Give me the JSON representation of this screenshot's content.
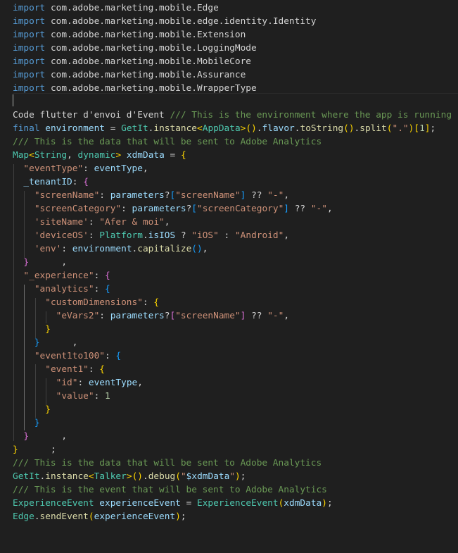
{
  "colors": {
    "background": "#1f1f1f",
    "keyword": "#569cd6",
    "control": "#c586c0",
    "type": "#4ec9b0",
    "function": "#dcdcaa",
    "variable": "#9cdcfe",
    "string": "#ce9178",
    "number": "#b5cea8",
    "comment": "#6a9955",
    "plain": "#d4d4d4",
    "bracket_level_1": "#ffd700",
    "bracket_level_2": "#da70d6",
    "bracket_level_3": "#179fff"
  },
  "code_lines": [
    [
      [
        "kw",
        "import"
      ],
      [
        "p",
        " com.adobe.marketing.mobile.Edge"
      ]
    ],
    [
      [
        "kw",
        "import"
      ],
      [
        "p",
        " com.adobe.marketing.mobile.edge.identity.Identity"
      ]
    ],
    [
      [
        "kw",
        "import"
      ],
      [
        "p",
        " com.adobe.marketing.mobile.Extension"
      ]
    ],
    [
      [
        "kw",
        "import"
      ],
      [
        "p",
        " com.adobe.marketing.mobile.LoggingMode"
      ]
    ],
    [
      [
        "kw",
        "import"
      ],
      [
        "p",
        " com.adobe.marketing.mobile.MobileCore"
      ]
    ],
    [
      [
        "kw",
        "import"
      ],
      [
        "p",
        " com.adobe.marketing.mobile.Assurance"
      ]
    ],
    [
      [
        "kw",
        "import"
      ],
      [
        "p",
        " com.adobe.marketing.mobile.WrapperType"
      ]
    ],
    [],
    [
      [
        "p",
        "Code flutter d'envoi d'Event "
      ],
      [
        "cmt",
        "/// This is the environment where the app is running"
      ]
    ],
    [
      [
        "kw",
        "final"
      ],
      [
        "p",
        " "
      ],
      [
        "var",
        "environment"
      ],
      [
        "p",
        " = "
      ],
      [
        "type",
        "GetIt"
      ],
      [
        "p",
        "."
      ],
      [
        "fn",
        "instance"
      ],
      [
        "b1",
        "<"
      ],
      [
        "type",
        "AppData"
      ],
      [
        "b1",
        ">"
      ],
      [
        "b1",
        "()"
      ],
      [
        "p",
        "."
      ],
      [
        "var",
        "flavor"
      ],
      [
        "p",
        "."
      ],
      [
        "fn",
        "toString"
      ],
      [
        "b1",
        "()"
      ],
      [
        "p",
        "."
      ],
      [
        "fn",
        "split"
      ],
      [
        "b1",
        "("
      ],
      [
        "str",
        "\".\""
      ],
      [
        "b1",
        ")"
      ],
      [
        "b1",
        "["
      ],
      [
        "num",
        "1"
      ],
      [
        "b1",
        "]"
      ],
      [
        "p",
        ";"
      ]
    ],
    [
      [
        "cmt",
        "/// This is the data that will be sent to Adobe Analytics"
      ]
    ],
    [
      [
        "type",
        "Map"
      ],
      [
        "b1",
        "<"
      ],
      [
        "type",
        "String"
      ],
      [
        "p",
        ", "
      ],
      [
        "type",
        "dynamic"
      ],
      [
        "b1",
        ">"
      ],
      [
        "p",
        " "
      ],
      [
        "var",
        "xdmData"
      ],
      [
        "p",
        " = "
      ],
      [
        "b1",
        "{"
      ]
    ],
    [
      [
        "p",
        "  "
      ],
      [
        "str",
        "\"eventType\""
      ],
      [
        "p",
        ": "
      ],
      [
        "var",
        "eventType"
      ],
      [
        "p",
        ","
      ]
    ],
    [
      [
        "p",
        "  "
      ],
      [
        "var",
        "_tenantID"
      ],
      [
        "p",
        ": "
      ],
      [
        "b2",
        "{"
      ]
    ],
    [
      [
        "p",
        "    "
      ],
      [
        "str",
        "\"screenName\""
      ],
      [
        "p",
        ": "
      ],
      [
        "var",
        "parameters"
      ],
      [
        "p",
        "?"
      ],
      [
        "b3",
        "["
      ],
      [
        "str",
        "\"screenName\""
      ],
      [
        "b3",
        "]"
      ],
      [
        "p",
        " ?? "
      ],
      [
        "str",
        "\"-\""
      ],
      [
        "p",
        ","
      ]
    ],
    [
      [
        "p",
        "    "
      ],
      [
        "str",
        "\"screenCategory\""
      ],
      [
        "p",
        ": "
      ],
      [
        "var",
        "parameters"
      ],
      [
        "p",
        "?"
      ],
      [
        "b3",
        "["
      ],
      [
        "str",
        "\"screenCategory\""
      ],
      [
        "b3",
        "]"
      ],
      [
        "p",
        " ?? "
      ],
      [
        "str",
        "\"-\""
      ],
      [
        "p",
        ","
      ]
    ],
    [
      [
        "p",
        "    "
      ],
      [
        "str",
        "'siteName'"
      ],
      [
        "p",
        ": "
      ],
      [
        "str",
        "\"Afer & moi\""
      ],
      [
        "p",
        ","
      ]
    ],
    [
      [
        "p",
        "    "
      ],
      [
        "str",
        "'deviceOS'"
      ],
      [
        "p",
        ": "
      ],
      [
        "type",
        "Platform"
      ],
      [
        "p",
        "."
      ],
      [
        "var",
        "isIOS"
      ],
      [
        "p",
        " ? "
      ],
      [
        "str",
        "\"iOS\""
      ],
      [
        "p",
        " : "
      ],
      [
        "str",
        "\"Android\""
      ],
      [
        "p",
        ","
      ]
    ],
    [
      [
        "p",
        "    "
      ],
      [
        "str",
        "'env'"
      ],
      [
        "p",
        ": "
      ],
      [
        "var",
        "environment"
      ],
      [
        "p",
        "."
      ],
      [
        "fn",
        "capitalize"
      ],
      [
        "b3",
        "()"
      ],
      [
        "p",
        ","
      ]
    ],
    [
      [
        "p",
        "  "
      ],
      [
        "b2",
        "}"
      ],
      [
        "p",
        "      ,"
      ]
    ],
    [
      [
        "p",
        "  "
      ],
      [
        "str",
        "\"_experience\""
      ],
      [
        "p",
        ": "
      ],
      [
        "b2",
        "{"
      ]
    ],
    [
      [
        "p",
        "    "
      ],
      [
        "str",
        "\"analytics\""
      ],
      [
        "p",
        ": "
      ],
      [
        "b3",
        "{"
      ]
    ],
    [
      [
        "p",
        "      "
      ],
      [
        "str",
        "\"customDimensions\""
      ],
      [
        "p",
        ": "
      ],
      [
        "b1",
        "{"
      ]
    ],
    [
      [
        "p",
        "        "
      ],
      [
        "str",
        "\"eVars2\""
      ],
      [
        "p",
        ": "
      ],
      [
        "var",
        "parameters"
      ],
      [
        "p",
        "?"
      ],
      [
        "b2",
        "["
      ],
      [
        "str",
        "\"screenName\""
      ],
      [
        "b2",
        "]"
      ],
      [
        "p",
        " ?? "
      ],
      [
        "str",
        "\"-\""
      ],
      [
        "p",
        ","
      ]
    ],
    [
      [
        "p",
        "      "
      ],
      [
        "b1",
        "}"
      ]
    ],
    [
      [
        "p",
        "    "
      ],
      [
        "b3",
        "}"
      ],
      [
        "p",
        "      ,"
      ]
    ],
    [
      [
        "p",
        "    "
      ],
      [
        "str",
        "\"event1to100\""
      ],
      [
        "p",
        ": "
      ],
      [
        "b3",
        "{"
      ]
    ],
    [
      [
        "p",
        "      "
      ],
      [
        "str",
        "\"event1\""
      ],
      [
        "p",
        ": "
      ],
      [
        "b1",
        "{"
      ]
    ],
    [
      [
        "p",
        "        "
      ],
      [
        "str",
        "\"id\""
      ],
      [
        "p",
        ": "
      ],
      [
        "var",
        "eventType"
      ],
      [
        "p",
        ","
      ]
    ],
    [
      [
        "p",
        "        "
      ],
      [
        "str",
        "\"value\""
      ],
      [
        "p",
        ": "
      ],
      [
        "num",
        "1"
      ]
    ],
    [
      [
        "p",
        "      "
      ],
      [
        "b1",
        "}"
      ]
    ],
    [
      [
        "p",
        "    "
      ],
      [
        "b3",
        "}"
      ]
    ],
    [
      [
        "p",
        "  "
      ],
      [
        "b2",
        "}"
      ],
      [
        "p",
        "      ,"
      ]
    ],
    [
      [
        "b1",
        "}"
      ],
      [
        "p",
        "      ;"
      ]
    ],
    [
      [
        "cmt",
        "/// This is the data that will be sent to Adobe Analytics"
      ]
    ],
    [
      [
        "type",
        "GetIt"
      ],
      [
        "p",
        "."
      ],
      [
        "fn",
        "instance"
      ],
      [
        "b1",
        "<"
      ],
      [
        "type",
        "Talker"
      ],
      [
        "b1",
        ">"
      ],
      [
        "b1",
        "()"
      ],
      [
        "p",
        "."
      ],
      [
        "fn",
        "debug"
      ],
      [
        "b1",
        "("
      ],
      [
        "str",
        "\""
      ],
      [
        "var",
        "$xdmData"
      ],
      [
        "str",
        "\""
      ],
      [
        "b1",
        ")"
      ],
      [
        "p",
        ";"
      ]
    ],
    [
      [
        "cmt",
        "/// This is the event that will be sent to Adobe Analytics"
      ]
    ],
    [
      [
        "type",
        "ExperienceEvent"
      ],
      [
        "p",
        " "
      ],
      [
        "var",
        "experienceEvent"
      ],
      [
        "p",
        " = "
      ],
      [
        "type",
        "ExperienceEvent"
      ],
      [
        "b1",
        "("
      ],
      [
        "var",
        "xdmData"
      ],
      [
        "b1",
        ")"
      ],
      [
        "p",
        ";"
      ]
    ],
    [
      [
        "type",
        "Edge"
      ],
      [
        "p",
        "."
      ],
      [
        "fn",
        "sendEvent"
      ],
      [
        "b1",
        "("
      ],
      [
        "var",
        "experienceEvent"
      ],
      [
        "b1",
        ")"
      ],
      [
        "p",
        ";"
      ]
    ]
  ]
}
